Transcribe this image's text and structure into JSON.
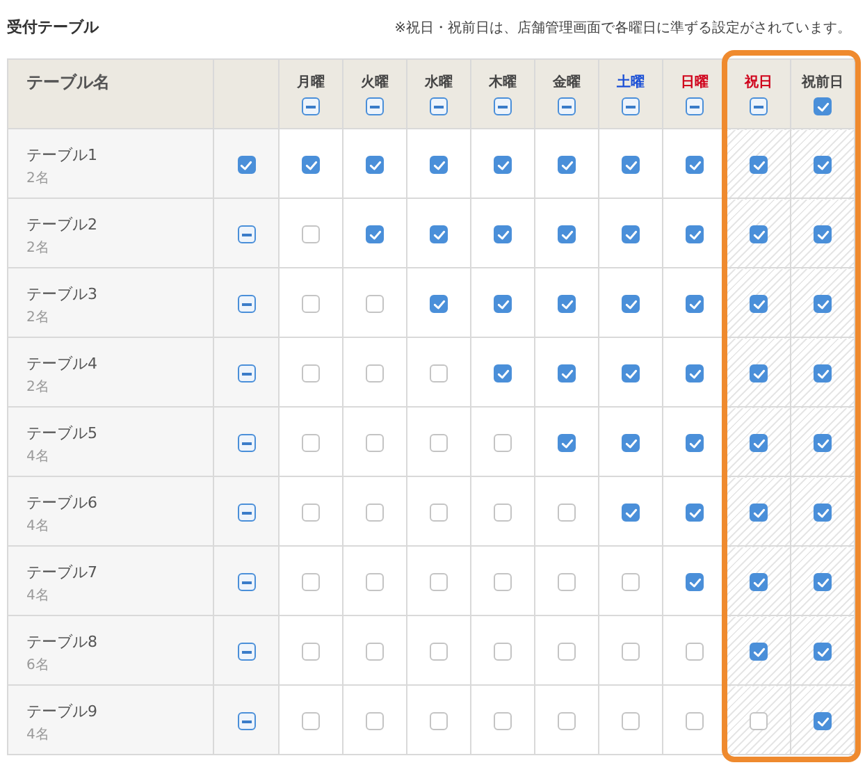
{
  "title": "受付テーブル",
  "note": "※祝日・祝前日は、店舗管理画面で各曜日に準ずる設定がされています。",
  "name_header": "テーブル名",
  "columns": [
    {
      "label": "月曜",
      "kind": "weekday",
      "color": "#444444",
      "checked": true,
      "indeterminate": true
    },
    {
      "label": "火曜",
      "kind": "weekday",
      "color": "#444444",
      "checked": true,
      "indeterminate": true
    },
    {
      "label": "水曜",
      "kind": "weekday",
      "color": "#444444",
      "checked": true,
      "indeterminate": true
    },
    {
      "label": "木曜",
      "kind": "weekday",
      "color": "#444444",
      "checked": true,
      "indeterminate": true
    },
    {
      "label": "金曜",
      "kind": "weekday",
      "color": "#444444",
      "checked": true,
      "indeterminate": true
    },
    {
      "label": "土曜",
      "kind": "weekday",
      "color": "#1a4fd6",
      "checked": true,
      "indeterminate": true
    },
    {
      "label": "日曜",
      "kind": "weekday",
      "color": "#d0021b",
      "checked": true,
      "indeterminate": true
    },
    {
      "label": "祝日",
      "kind": "holiday",
      "color": "#d0021b",
      "checked": true,
      "indeterminate": true
    },
    {
      "label": "祝前日",
      "kind": "holiday",
      "color": "#444444",
      "checked": true,
      "indeterminate": false
    }
  ],
  "rows": [
    {
      "name": "テーブル1",
      "capacity": "2名",
      "checked": true,
      "indeterminate": false,
      "cells": [
        {
          "checked": true
        },
        {
          "checked": true
        },
        {
          "checked": true
        },
        {
          "checked": true
        },
        {
          "checked": true
        },
        {
          "checked": true
        },
        {
          "checked": true
        },
        {
          "checked": true
        },
        {
          "checked": true
        }
      ]
    },
    {
      "name": "テーブル2",
      "capacity": "2名",
      "checked": true,
      "indeterminate": true,
      "cells": [
        {
          "checked": false
        },
        {
          "checked": true
        },
        {
          "checked": true
        },
        {
          "checked": true
        },
        {
          "checked": true
        },
        {
          "checked": true
        },
        {
          "checked": true
        },
        {
          "checked": true
        },
        {
          "checked": true
        }
      ]
    },
    {
      "name": "テーブル3",
      "capacity": "2名",
      "checked": true,
      "indeterminate": true,
      "cells": [
        {
          "checked": false
        },
        {
          "checked": false
        },
        {
          "checked": true
        },
        {
          "checked": true
        },
        {
          "checked": true
        },
        {
          "checked": true
        },
        {
          "checked": true
        },
        {
          "checked": true
        },
        {
          "checked": true
        }
      ]
    },
    {
      "name": "テーブル4",
      "capacity": "2名",
      "checked": true,
      "indeterminate": true,
      "cells": [
        {
          "checked": false
        },
        {
          "checked": false
        },
        {
          "checked": false
        },
        {
          "checked": true
        },
        {
          "checked": true
        },
        {
          "checked": true
        },
        {
          "checked": true
        },
        {
          "checked": true
        },
        {
          "checked": true
        }
      ]
    },
    {
      "name": "テーブル5",
      "capacity": "4名",
      "checked": true,
      "indeterminate": true,
      "cells": [
        {
          "checked": false
        },
        {
          "checked": false
        },
        {
          "checked": false
        },
        {
          "checked": false
        },
        {
          "checked": true
        },
        {
          "checked": true
        },
        {
          "checked": true
        },
        {
          "checked": true
        },
        {
          "checked": true
        }
      ]
    },
    {
      "name": "テーブル6",
      "capacity": "4名",
      "checked": true,
      "indeterminate": true,
      "cells": [
        {
          "checked": false
        },
        {
          "checked": false
        },
        {
          "checked": false
        },
        {
          "checked": false
        },
        {
          "checked": false
        },
        {
          "checked": true
        },
        {
          "checked": true
        },
        {
          "checked": true
        },
        {
          "checked": true
        }
      ]
    },
    {
      "name": "テーブル7",
      "capacity": "4名",
      "checked": true,
      "indeterminate": true,
      "cells": [
        {
          "checked": false
        },
        {
          "checked": false
        },
        {
          "checked": false
        },
        {
          "checked": false
        },
        {
          "checked": false
        },
        {
          "checked": false
        },
        {
          "checked": true
        },
        {
          "checked": true
        },
        {
          "checked": true
        }
      ]
    },
    {
      "name": "テーブル8",
      "capacity": "6名",
      "checked": true,
      "indeterminate": true,
      "cells": [
        {
          "checked": false
        },
        {
          "checked": false
        },
        {
          "checked": false
        },
        {
          "checked": false
        },
        {
          "checked": false
        },
        {
          "checked": false
        },
        {
          "checked": false
        },
        {
          "checked": true
        },
        {
          "checked": true
        }
      ]
    },
    {
      "name": "テーブル9",
      "capacity": "4名",
      "checked": true,
      "indeterminate": true,
      "cells": [
        {
          "checked": false
        },
        {
          "checked": false
        },
        {
          "checked": false
        },
        {
          "checked": false
        },
        {
          "checked": false
        },
        {
          "checked": false
        },
        {
          "checked": false
        },
        {
          "checked": false
        },
        {
          "checked": true
        }
      ]
    }
  ]
}
